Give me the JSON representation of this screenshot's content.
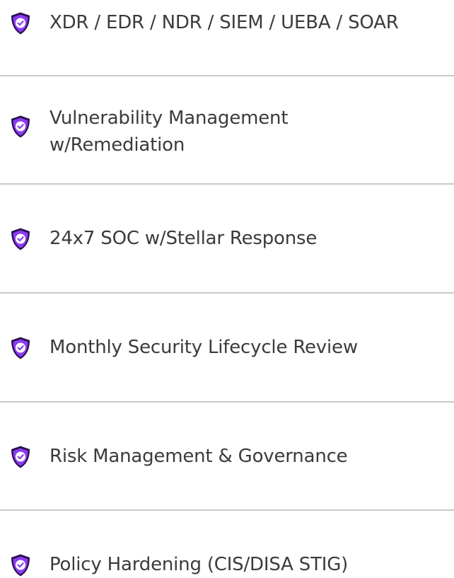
{
  "brand": {
    "accent": "#8b3cf2",
    "accent_dark": "#2a0f4f",
    "divider": "#c9c9c9",
    "text": "#3b3b3b"
  },
  "features": [
    {
      "label": "XDR / EDR / NDR / SIEM / UEBA / SOAR",
      "icon": "shield-check-icon"
    },
    {
      "label_line1": "Vulnerability Management",
      "label_line2": "w/Remediation",
      "icon": "shield-check-icon"
    },
    {
      "label": "24x7 SOC w/Stellar Response",
      "icon": "shield-check-icon"
    },
    {
      "label": "Monthly Security Lifecycle Review",
      "icon": "shield-check-icon"
    },
    {
      "label": "Risk Management & Governance",
      "icon": "shield-check-icon"
    },
    {
      "label": "Policy Hardening (CIS/DISA STIG)",
      "icon": "shield-check-icon"
    }
  ]
}
